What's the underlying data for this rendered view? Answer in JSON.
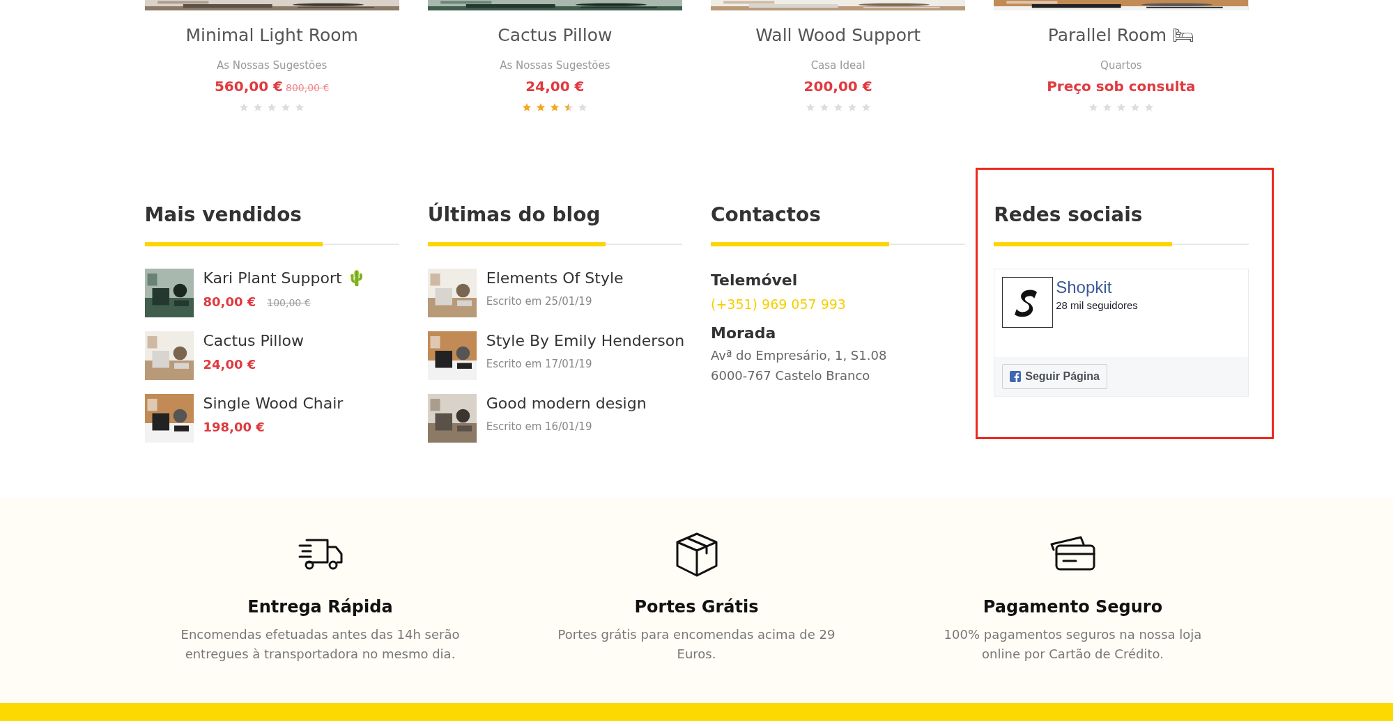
{
  "products": [
    {
      "name": "Minimal Light Room",
      "category": "As Nossas Sugestões",
      "price": "560,00 €",
      "old_price": "800,00 €",
      "stars": 0
    },
    {
      "name": "Cactus Pillow",
      "category": "As Nossas Sugestões",
      "price": "24,00 €",
      "stars": 3.5
    },
    {
      "name": "Wall Wood Support",
      "category": "Casa Ideal",
      "price": "200,00 €",
      "stars": 0
    },
    {
      "name": "Parallel Room 🛏",
      "category": "Quartos",
      "price": "Preço sob consulta",
      "stars": 0
    }
  ],
  "best_sellers": {
    "title": "Mais vendidos",
    "items": [
      {
        "name": "Kari Plant Support 🌵",
        "price": "80,00 €",
        "old_price": "100,00 €"
      },
      {
        "name": "Cactus Pillow",
        "price": "24,00 €"
      },
      {
        "name": "Single Wood Chair",
        "price": "198,00 €"
      }
    ]
  },
  "blog": {
    "title": "Últimas do blog",
    "posts": [
      {
        "title": "Elements Of Style",
        "date": "Escrito em 25/01/19"
      },
      {
        "title": "Style By Emily Henderson",
        "date": "Escrito em 17/01/19"
      },
      {
        "title": "Good modern design",
        "date": "Escrito em 16/01/19"
      }
    ]
  },
  "contacts": {
    "title": "Contactos",
    "phone_label": "Telemóvel",
    "phone": "(+351) 969 057 993",
    "address_label": "Morada",
    "address_lines": [
      "Avª do Empresário, 1, S1.08",
      "6000-767 Castelo Branco"
    ]
  },
  "social": {
    "title": "Redes sociais",
    "highlighted": true,
    "page_name": "Shopkit",
    "followers": "28 mil seguidores",
    "follow_button": "Seguir Página"
  },
  "features": [
    {
      "kind": "truck",
      "title": "Entrega Rápida",
      "text": "Encomendas efetuadas antes das 14h serão entregues à transportadora no mesmo dia."
    },
    {
      "kind": "box",
      "title": "Portes Grátis",
      "text": "Portes grátis para encomendas acima de 29 Euros."
    },
    {
      "kind": "card",
      "title": "Pagamento Seguro",
      "text": "100% pagamentos seguros na nossa loja online por Cartão de Crédito."
    }
  ]
}
